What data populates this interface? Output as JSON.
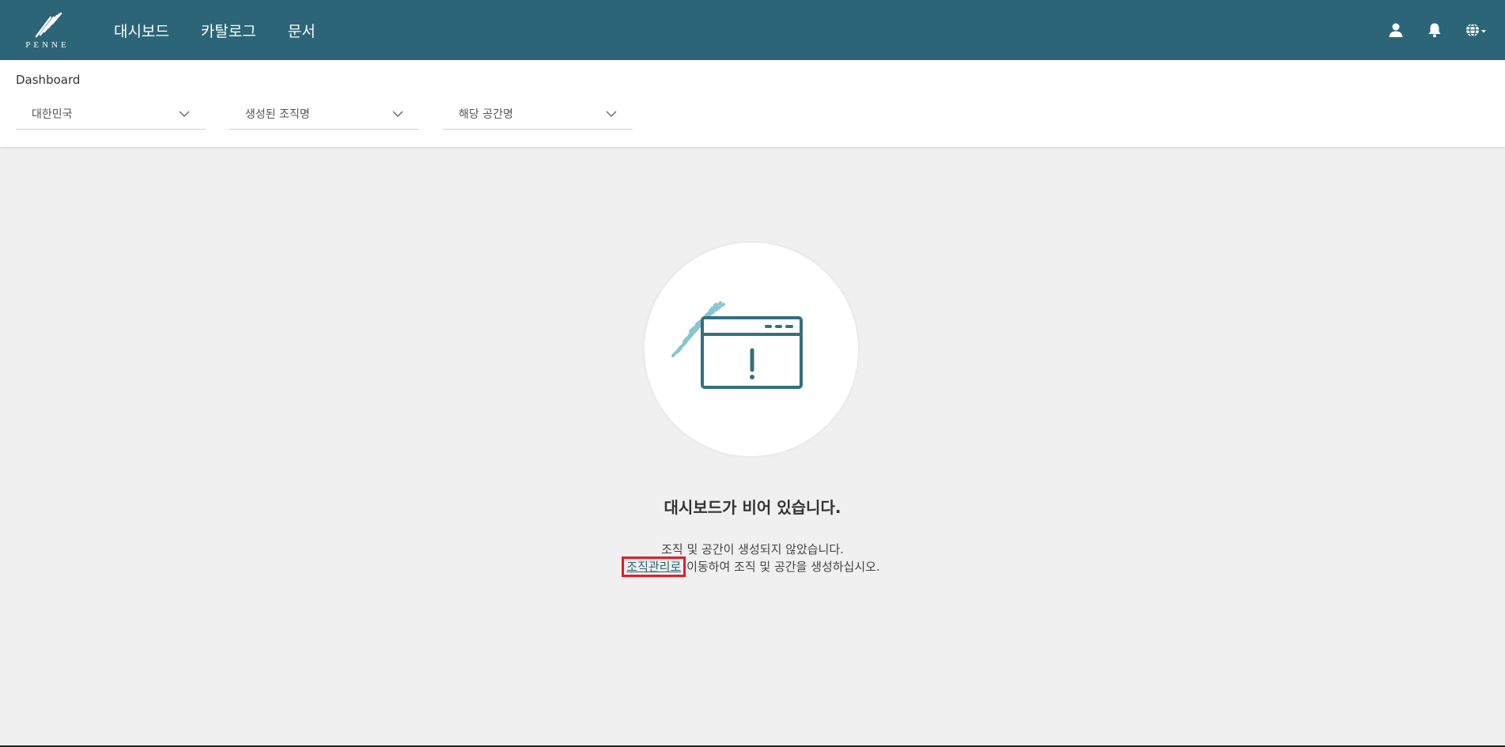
{
  "brand": {
    "name": "PENNE"
  },
  "nav": {
    "items": [
      {
        "label": "대시보드"
      },
      {
        "label": "카탈로그"
      },
      {
        "label": "문서"
      }
    ]
  },
  "top_icons": [
    "user-icon",
    "bell-icon",
    "globe-icon"
  ],
  "header": {
    "title": "Dashboard"
  },
  "filters": [
    {
      "value": "대한민국"
    },
    {
      "value": "생성된 조직명"
    },
    {
      "value": "해당 공간명"
    }
  ],
  "empty_state": {
    "title": "대시보드가 비어 있습니다.",
    "line1": "조직 및 공간이 생성되지 않았습니다.",
    "link_label": "조직관리로",
    "line2_rest": " 이동하여 조직 및 공간을 생성하십시오."
  },
  "colors": {
    "nav_bg": "#2c6577",
    "page_bg": "#eff0ef",
    "highlight": "#e21d27",
    "illustration_dark": "#35707e",
    "illustration_light": "#89c4d3"
  }
}
